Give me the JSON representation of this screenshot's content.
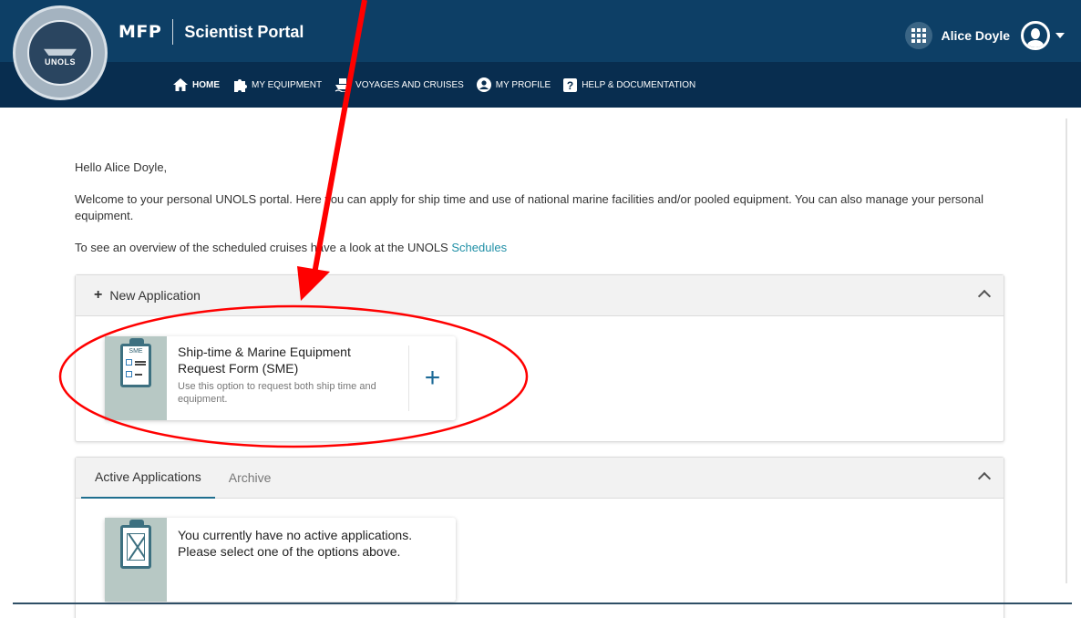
{
  "header": {
    "brand": "MFP",
    "title": "Scientist Portal",
    "user_name": "Alice Doyle",
    "logo_text": "UNOLS"
  },
  "nav": {
    "items": [
      {
        "label": "HOME",
        "icon": "home-icon"
      },
      {
        "label": "MY EQUIPMENT",
        "icon": "puzzle-icon"
      },
      {
        "label": "VOYAGES AND CRUISES",
        "icon": "ship-icon"
      },
      {
        "label": "MY PROFILE",
        "icon": "user-circle-icon"
      },
      {
        "label": "HELP & DOCUMENTATION",
        "icon": "help-icon"
      }
    ]
  },
  "main": {
    "greeting": "Hello Alice Doyle,",
    "welcome": "Welcome to your personal UNOLS portal. Here you can apply for ship time and use of national marine facilities and/or pooled equipment. You can also manage your personal equipment.",
    "overview_prefix": "To see an overview of the scheduled cruises have a look at the UNOLS",
    "overview_link": "Schedules"
  },
  "new_application": {
    "header": "New Application",
    "card": {
      "icon_label": "SME",
      "title": "Ship-time & Marine Equipment Request Form (SME)",
      "description": "Use this option to request both ship time and equipment."
    }
  },
  "applications": {
    "tabs": [
      "Active Applications",
      "Archive"
    ],
    "empty_message": "You currently have no active applications. Please select one of the options above."
  },
  "annotation": {
    "color": "#ff0000"
  }
}
